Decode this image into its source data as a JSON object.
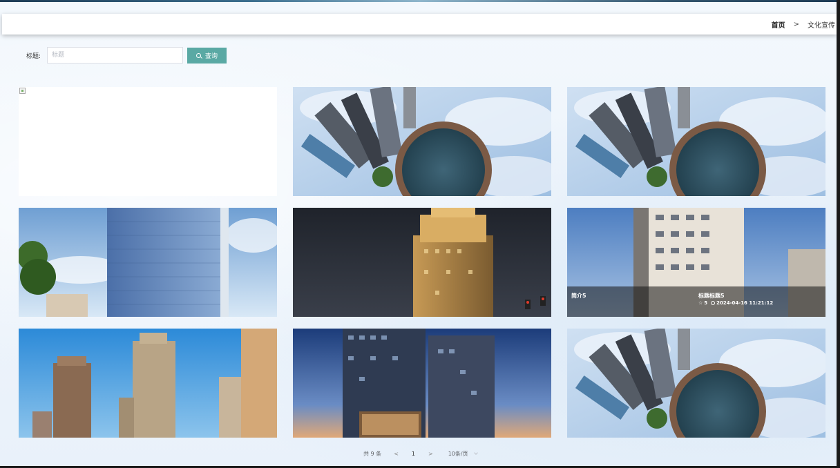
{
  "breadcrumb": {
    "home": "首页",
    "separator": ">",
    "current": "文化宣传"
  },
  "search": {
    "label": "标题:",
    "placeholder": "标题",
    "value": "",
    "button_label": "查询",
    "button_icon": "search-icon"
  },
  "cards": [
    {
      "image": "broken-image",
      "overlay": false
    },
    {
      "image": "tiny-planet-city",
      "overlay": false
    },
    {
      "image": "tiny-planet-city",
      "overlay": false
    },
    {
      "image": "glass-office-tower",
      "overlay": false
    },
    {
      "image": "night-lit-tower",
      "overlay": false
    },
    {
      "image": "residential-tower",
      "overlay": true,
      "description": "简介5",
      "title": "标题标题5",
      "stars": "5",
      "time": "2024-04-16 11:21:12"
    },
    {
      "image": "residential-highrises",
      "overlay": false
    },
    {
      "image": "dusk-office-towers",
      "overlay": false
    },
    {
      "image": "tiny-planet-city",
      "overlay": false
    }
  ],
  "pagination": {
    "total": "共 9 条",
    "prev": "<",
    "page": "1",
    "next": ">",
    "page_size": "10条/页"
  },
  "colors": {
    "accent": "#5aa9a4",
    "background": "#eef4fb"
  }
}
